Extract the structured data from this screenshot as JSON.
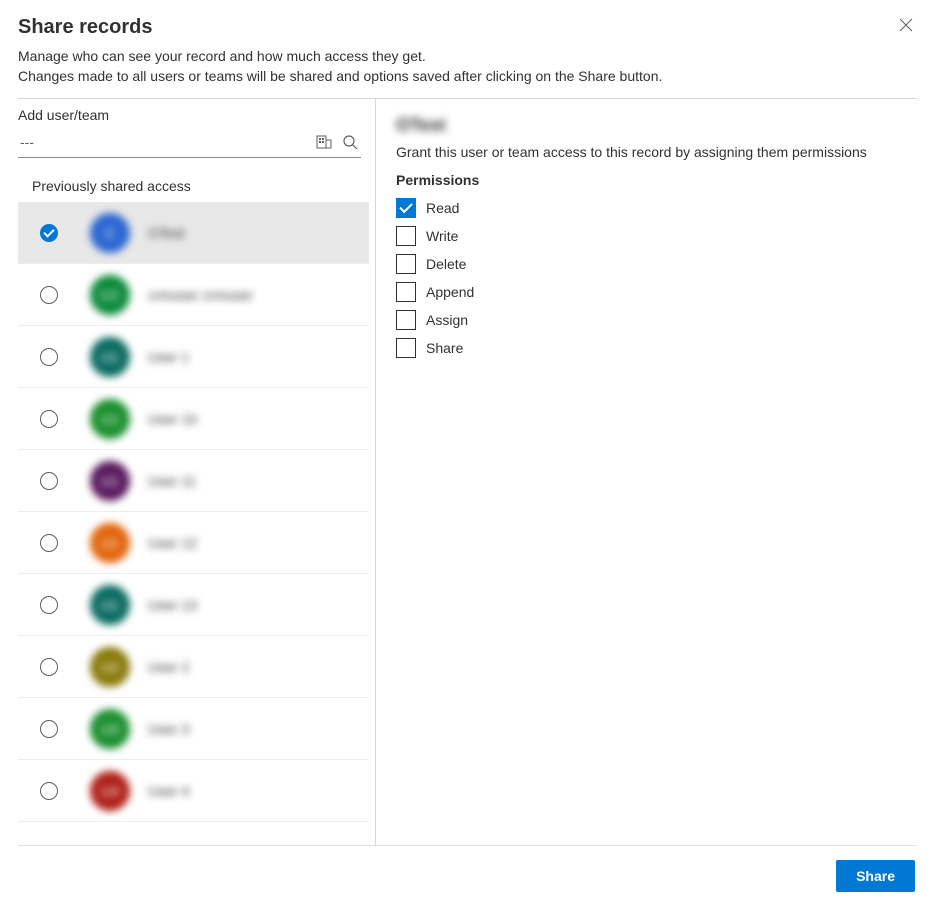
{
  "header": {
    "title": "Share records",
    "description_line1": "Manage who can see your record and how much access they get.",
    "description_line2": "Changes made to all users or teams will be shared and options saved after clicking on the Share button."
  },
  "left": {
    "add_label": "Add user/team",
    "input_value": "---",
    "icon_building": "building-icon",
    "icon_search": "search-icon",
    "section_label": "Previously shared access",
    "items": [
      {
        "initials": "C",
        "name": "OTest",
        "color": "#2b66d2",
        "selected": true
      },
      {
        "initials": "CC",
        "name": "crmuser crmuser",
        "color": "#0b8a3a",
        "selected": false
      },
      {
        "initials": "U1",
        "name": "User 1",
        "color": "#0b6b62",
        "selected": false
      },
      {
        "initials": "U1",
        "name": "User 10",
        "color": "#1a8f2e",
        "selected": false
      },
      {
        "initials": "U1",
        "name": "User 11",
        "color": "#5a1a5e",
        "selected": false
      },
      {
        "initials": "U1",
        "name": "User 12",
        "color": "#e2640b",
        "selected": false
      },
      {
        "initials": "U1",
        "name": "User 13",
        "color": "#0b6b62",
        "selected": false
      },
      {
        "initials": "U2",
        "name": "User 2",
        "color": "#8a7a0b",
        "selected": false
      },
      {
        "initials": "U3",
        "name": "User 3",
        "color": "#1a8f2e",
        "selected": false
      },
      {
        "initials": "U4",
        "name": "User 4",
        "color": "#b0201a",
        "selected": false
      }
    ]
  },
  "right": {
    "selected_name": "OTest",
    "instruction": "Grant this user or team access to this record by assigning them permissions",
    "permissions_label": "Permissions",
    "permissions": [
      {
        "name": "Read",
        "checked": true
      },
      {
        "name": "Write",
        "checked": false
      },
      {
        "name": "Delete",
        "checked": false
      },
      {
        "name": "Append",
        "checked": false
      },
      {
        "name": "Assign",
        "checked": false
      },
      {
        "name": "Share",
        "checked": false
      }
    ]
  },
  "footer": {
    "share_label": "Share"
  }
}
